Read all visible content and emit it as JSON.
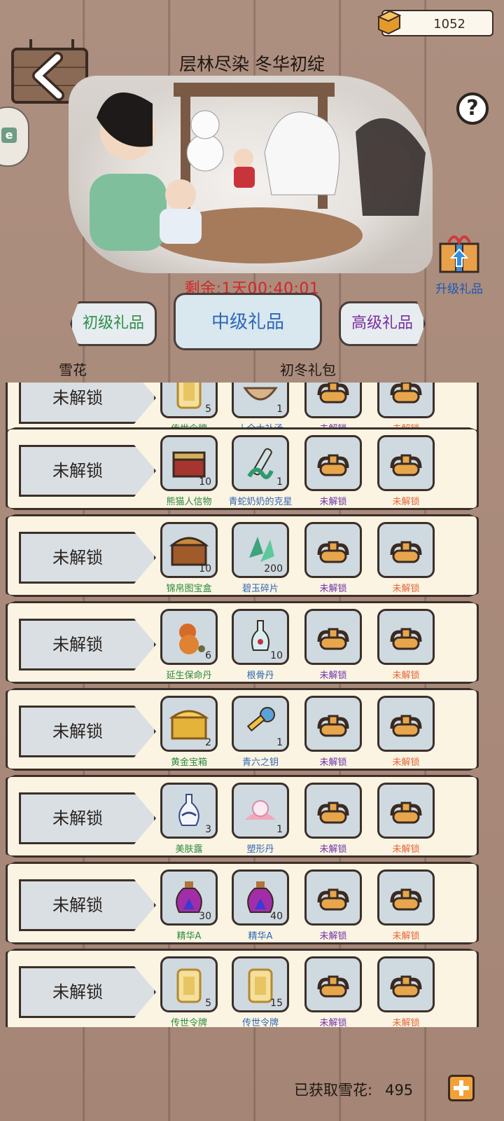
{
  "currency": {
    "icon": "gold-ingot-icon",
    "value": "1052"
  },
  "header": {
    "title": "层林尽染 冬华初绽"
  },
  "countdown": {
    "label": "剩余:",
    "time": "1天00:40:01"
  },
  "upgrade_gift": {
    "label": "升级礼品",
    "icon": "gift-box-icon"
  },
  "tiers": [
    {
      "label": "初级礼品",
      "color": "#2f8f4c"
    },
    {
      "label": "中级礼品",
      "color": "#2e67b9",
      "selected": true
    },
    {
      "label": "高级礼品",
      "color": "#7a2fa1"
    }
  ],
  "columns": {
    "left": "雪花",
    "right": "初冬礼包"
  },
  "rows": [
    {
      "lock": "未解锁",
      "items": [
        {
          "name": "传世令牌",
          "count": "5",
          "icon": "token-plaque-icon",
          "color": "g"
        },
        {
          "name": "十全大补汤",
          "count": "1",
          "icon": "bowl-soup-icon",
          "color": "b"
        },
        {
          "name": "未解锁",
          "count": "",
          "icon": "lock-icon",
          "color": "p"
        },
        {
          "name": "未解锁",
          "count": "",
          "icon": "lock-icon",
          "color": "o"
        }
      ]
    },
    {
      "lock": "未解锁",
      "items": [
        {
          "name": "熊猫人信物",
          "count": "10",
          "icon": "ornate-box-icon",
          "color": "g"
        },
        {
          "name": "青蛇奶奶的克星",
          "count": "1",
          "icon": "snake-bottle-icon",
          "color": "b"
        },
        {
          "name": "未解锁",
          "count": "",
          "icon": "lock-icon",
          "color": "p"
        },
        {
          "name": "未解锁",
          "count": "",
          "icon": "lock-icon",
          "color": "o"
        }
      ]
    },
    {
      "lock": "未解锁",
      "items": [
        {
          "name": "锦帛图宝盒",
          "count": "10",
          "icon": "treasure-chest-icon",
          "color": "g"
        },
        {
          "name": "碧玉碎片",
          "count": "200",
          "icon": "jade-shard-icon",
          "color": "b"
        },
        {
          "name": "未解锁",
          "count": "",
          "icon": "lock-icon",
          "color": "p"
        },
        {
          "name": "未解锁",
          "count": "",
          "icon": "lock-icon",
          "color": "o"
        }
      ]
    },
    {
      "lock": "未解锁",
      "items": [
        {
          "name": "延生保命丹",
          "count": "6",
          "icon": "gourd-pill-icon",
          "color": "g"
        },
        {
          "name": "根骨丹",
          "count": "10",
          "icon": "vase-icon",
          "color": "b"
        },
        {
          "name": "未解锁",
          "count": "",
          "icon": "lock-icon",
          "color": "p"
        },
        {
          "name": "未解锁",
          "count": "",
          "icon": "lock-icon",
          "color": "o"
        }
      ]
    },
    {
      "lock": "未解锁",
      "items": [
        {
          "name": "黄金宝箱",
          "count": "2",
          "icon": "gold-chest-icon",
          "color": "g"
        },
        {
          "name": "青六之钥",
          "count": "1",
          "icon": "key-icon",
          "color": "b"
        },
        {
          "name": "未解锁",
          "count": "",
          "icon": "lock-icon",
          "color": "p"
        },
        {
          "name": "未解锁",
          "count": "",
          "icon": "lock-icon",
          "color": "o"
        }
      ]
    },
    {
      "lock": "未解锁",
      "items": [
        {
          "name": "美肤露",
          "count": "3",
          "icon": "porcelain-bottle-icon",
          "color": "g"
        },
        {
          "name": "塑形丹",
          "count": "1",
          "icon": "pearl-lotus-icon",
          "color": "b"
        },
        {
          "name": "未解锁",
          "count": "",
          "icon": "lock-icon",
          "color": "p"
        },
        {
          "name": "未解锁",
          "count": "",
          "icon": "lock-icon",
          "color": "o"
        }
      ]
    },
    {
      "lock": "未解锁",
      "items": [
        {
          "name": "精华A",
          "count": "30",
          "icon": "purple-potion-icon",
          "color": "g"
        },
        {
          "name": "精华A",
          "count": "40",
          "icon": "purple-potion-icon",
          "color": "b"
        },
        {
          "name": "未解锁",
          "count": "",
          "icon": "lock-icon",
          "color": "p"
        },
        {
          "name": "未解锁",
          "count": "",
          "icon": "lock-icon",
          "color": "o"
        }
      ]
    },
    {
      "lock": "未解锁",
      "items": [
        {
          "name": "传世令牌",
          "count": "5",
          "icon": "token-plaque-icon",
          "color": "g"
        },
        {
          "name": "传世令牌",
          "count": "15",
          "icon": "token-plaque-icon",
          "color": "b"
        },
        {
          "name": "未解锁",
          "count": "",
          "icon": "lock-icon",
          "color": "p"
        },
        {
          "name": "未解锁",
          "count": "",
          "icon": "lock-icon",
          "color": "o"
        }
      ]
    }
  ],
  "footer": {
    "label": "已获取雪花:",
    "value": "495"
  }
}
